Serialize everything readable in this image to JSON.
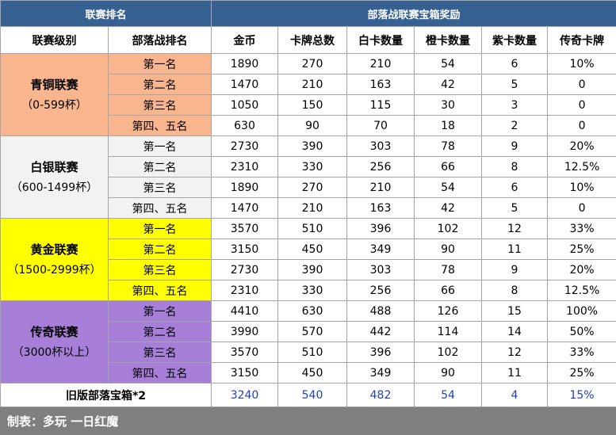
{
  "headers": {
    "group_left": "联赛排名",
    "group_right": "部落战联赛宝箱奖励",
    "col_level": "联赛级别",
    "col_rank": "部落战排名",
    "col_gold": "金币",
    "col_total": "卡牌总数",
    "col_white": "白卡数量",
    "col_orange": "橙卡数量",
    "col_purple": "紫卡数量",
    "col_legend": "传奇卡牌"
  },
  "tiers": [
    {
      "name": "青铜联赛",
      "range": "（0-599杯）",
      "color": "#f8b58e",
      "rows": [
        {
          "rank": "第一名",
          "gold": "1890",
          "total": "270",
          "white": "210",
          "orange": "54",
          "purple": "6",
          "legend": "10%"
        },
        {
          "rank": "第二名",
          "gold": "1470",
          "total": "210",
          "white": "163",
          "orange": "42",
          "purple": "5",
          "legend": "0"
        },
        {
          "rank": "第三名",
          "gold": "1050",
          "total": "150",
          "white": "115",
          "orange": "30",
          "purple": "3",
          "legend": "0"
        },
        {
          "rank": "第四、五名",
          "gold": "630",
          "total": "90",
          "white": "70",
          "orange": "18",
          "purple": "2",
          "legend": "0"
        }
      ]
    },
    {
      "name": "白银联赛",
      "range": "（600-1499杯）",
      "color": "#f2f2f2",
      "rows": [
        {
          "rank": "第一名",
          "gold": "2730",
          "total": "390",
          "white": "303",
          "orange": "78",
          "purple": "9",
          "legend": "20%"
        },
        {
          "rank": "第二名",
          "gold": "2310",
          "total": "330",
          "white": "256",
          "orange": "66",
          "purple": "8",
          "legend": "12.5%"
        },
        {
          "rank": "第三名",
          "gold": "1890",
          "total": "270",
          "white": "210",
          "orange": "54",
          "purple": "6",
          "legend": "10%"
        },
        {
          "rank": "第四、五名",
          "gold": "1470",
          "total": "210",
          "white": "163",
          "orange": "42",
          "purple": "5",
          "legend": "0"
        }
      ]
    },
    {
      "name": "黄金联赛",
      "range": "（1500-2999杯）",
      "color": "#ffff00",
      "rows": [
        {
          "rank": "第一名",
          "gold": "3570",
          "total": "510",
          "white": "396",
          "orange": "102",
          "purple": "12",
          "legend": "33%"
        },
        {
          "rank": "第二名",
          "gold": "3150",
          "total": "450",
          "white": "349",
          "orange": "90",
          "purple": "11",
          "legend": "25%"
        },
        {
          "rank": "第三名",
          "gold": "2730",
          "total": "390",
          "white": "303",
          "orange": "78",
          "purple": "9",
          "legend": "20%"
        },
        {
          "rank": "第四、五名",
          "gold": "2310",
          "total": "330",
          "white": "256",
          "orange": "66",
          "purple": "8",
          "legend": "12.5%"
        }
      ]
    },
    {
      "name": "传奇联赛",
      "range": "（3000杯以上）",
      "color": "#a77ed8",
      "rows": [
        {
          "rank": "第一名",
          "gold": "4410",
          "total": "630",
          "white": "488",
          "orange": "126",
          "purple": "15",
          "legend": "100%"
        },
        {
          "rank": "第二名",
          "gold": "3990",
          "total": "570",
          "white": "442",
          "orange": "114",
          "purple": "14",
          "legend": "50%"
        },
        {
          "rank": "第三名",
          "gold": "3570",
          "total": "510",
          "white": "396",
          "orange": "102",
          "purple": "12",
          "legend": "33%"
        },
        {
          "rank": "第四、五名",
          "gold": "3150",
          "total": "450",
          "white": "349",
          "orange": "90",
          "purple": "11",
          "legend": "25%"
        }
      ]
    }
  ],
  "old_version": {
    "label": "旧版部落宝箱*2",
    "gold": "3240",
    "total": "540",
    "white": "482",
    "orange": "54",
    "purple": "4",
    "legend": "15%"
  },
  "footer": "制表：多玩 一日红魔"
}
